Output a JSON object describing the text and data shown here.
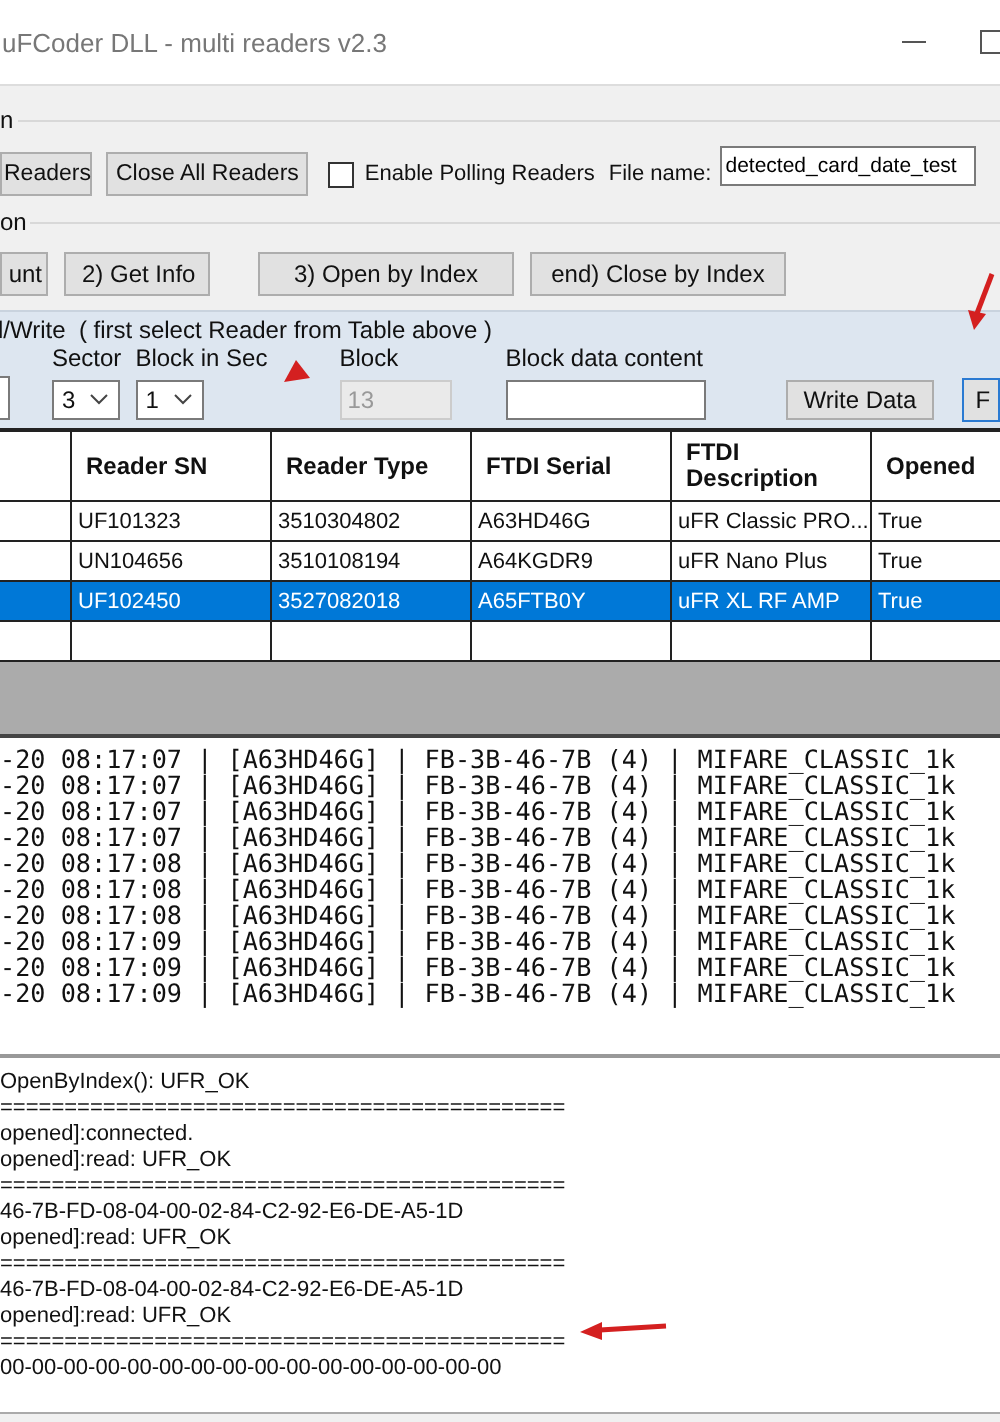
{
  "window": {
    "title": "uFCoder DLL - multi readers v2.3"
  },
  "reader_group": {
    "title": "n",
    "buttons": [
      "Readers",
      "Close All Readers"
    ],
    "polling_checkbox": {
      "label": "Enable Polling Readers",
      "checked": false
    },
    "file_name": {
      "label": "File name:",
      "value": "detected_card_date_test"
    }
  },
  "function_group": {
    "title": "on",
    "buttons": [
      "unt",
      "2) Get Info",
      "3) Open by Index",
      "end) Close by Index"
    ]
  },
  "rw_panel": {
    "title": "l/Write  ( first select Reader from Table above )",
    "sector": {
      "label": "Sector",
      "value": "3"
    },
    "block_in_sec": {
      "label": "Block in Sec",
      "value": "1"
    },
    "block": {
      "label": "Block",
      "value": "13",
      "disabled": true
    },
    "block_data": {
      "label": "Block data content"
    },
    "write_button": "Write Data",
    "cut_button": "F"
  },
  "table": {
    "columns": [
      "Reader SN",
      "Reader Type",
      "FTDI Serial",
      "FTDI Description",
      "Opened"
    ],
    "rows": [
      {
        "cells": [
          "UF101323",
          "3510304802",
          "A63HD46G",
          "uFR Classic PRO...",
          "True"
        ],
        "selected": false
      },
      {
        "cells": [
          "UN104656",
          "3510108194",
          "A64KGDR9",
          "uFR Nano Plus",
          "True"
        ],
        "selected": false
      },
      {
        "cells": [
          "UF102450",
          "3527082018",
          "A65FTB0Y",
          "uFR XL RF AMP",
          "True"
        ],
        "selected": true
      }
    ]
  },
  "polling_log": [
    "-20 08:17:07 | [A63HD46G] | FB-3B-46-7B (4) | MIFARE_CLASSIC_1k",
    "-20 08:17:07 | [A63HD46G] | FB-3B-46-7B (4) | MIFARE_CLASSIC_1k",
    "-20 08:17:07 | [A63HD46G] | FB-3B-46-7B (4) | MIFARE_CLASSIC_1k",
    "-20 08:17:07 | [A63HD46G] | FB-3B-46-7B (4) | MIFARE_CLASSIC_1k",
    "-20 08:17:08 | [A63HD46G] | FB-3B-46-7B (4) | MIFARE_CLASSIC_1k",
    "-20 08:17:08 | [A63HD46G] | FB-3B-46-7B (4) | MIFARE_CLASSIC_1k",
    "-20 08:17:08 | [A63HD46G] | FB-3B-46-7B (4) | MIFARE_CLASSIC_1k",
    "-20 08:17:09 | [A63HD46G] | FB-3B-46-7B (4) | MIFARE_CLASSIC_1k",
    "-20 08:17:09 | [A63HD46G] | FB-3B-46-7B (4) | MIFARE_CLASSIC_1k",
    "-20 08:17:09 | [A63HD46G] | FB-3B-46-7B (4) | MIFARE_CLASSIC_1k"
  ],
  "output_log": [
    "OpenByIndex(): UFR_OK",
    "============================================",
    "opened]:connected.",
    "opened]:read: UFR_OK",
    "============================================",
    "46-7B-FD-08-04-00-02-84-C2-92-E6-DE-A5-1D",
    "opened]:read: UFR_OK",
    "============================================",
    "46-7B-FD-08-04-00-02-84-C2-92-E6-DE-A5-1D",
    "opened]:read: UFR_OK",
    "============================================",
    "00-00-00-00-00-00-00-00-00-00-00-00-00-00-00-00"
  ]
}
